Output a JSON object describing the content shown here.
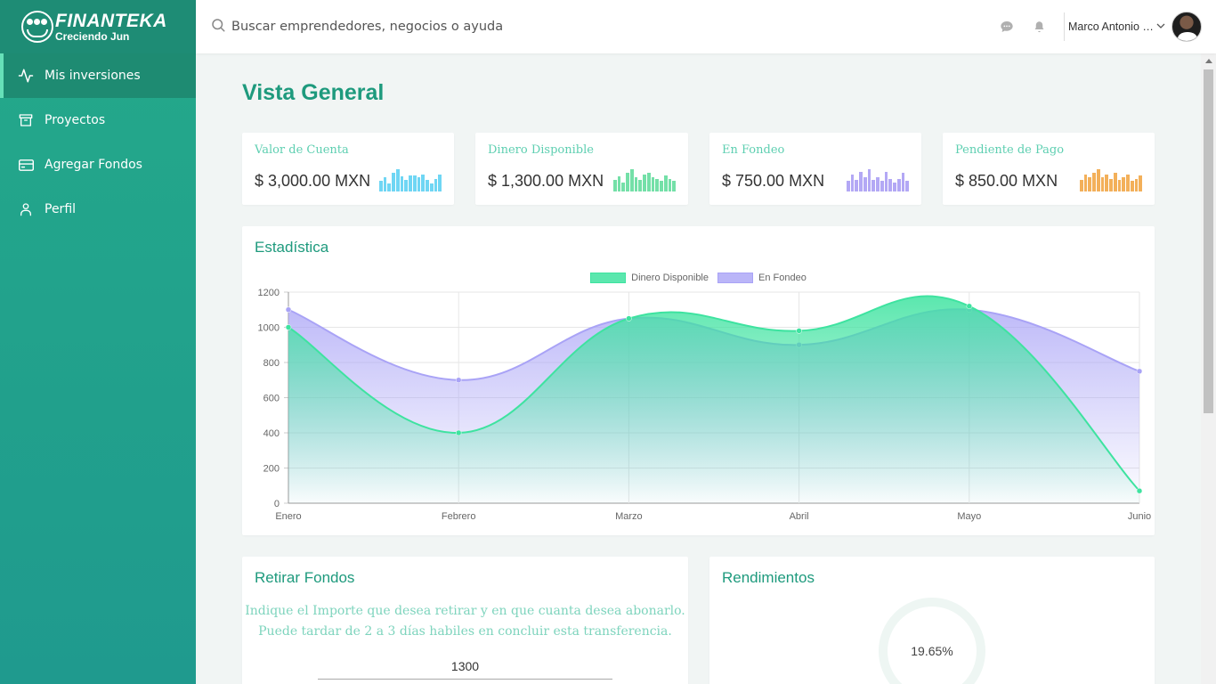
{
  "app": {
    "logo_name": "FINANTEKA",
    "logo_sub": "Creciendo Jun"
  },
  "sidebar": {
    "items": [
      {
        "label": "Mis inversiones",
        "icon": "activity-icon",
        "active": true
      },
      {
        "label": "Proyectos",
        "icon": "archive-icon",
        "active": false
      },
      {
        "label": "Agregar Fondos",
        "icon": "credit-card-icon",
        "active": false
      },
      {
        "label": "Perfil",
        "icon": "user-icon",
        "active": false
      }
    ]
  },
  "topbar": {
    "search_placeholder": "Buscar emprendedores, negocios o ayuda",
    "user_name": "Marco Antonio Me..."
  },
  "main": {
    "title": "Vista General",
    "stats": [
      {
        "label": "Valor de Cuenta",
        "value": "$ 3,000.00 MXN",
        "color": "#6fd6f4",
        "spark": [
          0.45,
          0.6,
          0.35,
          0.8,
          0.95,
          0.65,
          0.5,
          0.7,
          0.7,
          0.6,
          0.75,
          0.5,
          0.35,
          0.55,
          0.75
        ]
      },
      {
        "label": "Dinero Disponible",
        "value": "$ 1,300.00 MXN",
        "color": "#74e0a8",
        "spark": [
          0.5,
          0.65,
          0.4,
          0.8,
          0.95,
          0.6,
          0.5,
          0.75,
          0.8,
          0.6,
          0.55,
          0.45,
          0.7,
          0.55,
          0.45
        ]
      },
      {
        "label": "En Fondeo",
        "value": "$ 750.00 MXN",
        "color": "#b3a8f5",
        "spark": [
          0.45,
          0.75,
          0.5,
          0.85,
          0.6,
          0.95,
          0.5,
          0.6,
          0.45,
          0.85,
          0.55,
          0.4,
          0.55,
          0.8,
          0.45
        ]
      },
      {
        "label": "Pendiente de Pago",
        "value": "$ 850.00 MXN",
        "color": "#f3b05a",
        "spark": [
          0.5,
          0.75,
          0.6,
          0.8,
          0.95,
          0.6,
          0.75,
          0.55,
          0.8,
          0.5,
          0.6,
          0.75,
          0.45,
          0.55,
          0.7
        ]
      }
    ],
    "stats_card_title": "Estadística",
    "withdraw": {
      "title": "Retirar Fondos",
      "line1": "Indique el Importe que desea retirar y en que cuanta desea abonarlo.",
      "line2": "Puede tardar de 2 a 3 días habiles en concluir esta transferencia.",
      "amount": "1300"
    },
    "returns": {
      "title": "Rendimientos",
      "value": "19.65%"
    }
  },
  "chart_data": {
    "type": "area",
    "categories": [
      "Enero",
      "Febrero",
      "Marzo",
      "Abril",
      "Mayo",
      "Junio"
    ],
    "series": [
      {
        "name": "Dinero Disponible",
        "values": [
          1000,
          400,
          1050,
          980,
          1120,
          70
        ],
        "color": "#3ee3a0"
      },
      {
        "name": "En Fondeo",
        "values": [
          1100,
          700,
          1050,
          900,
          1100,
          750
        ],
        "color": "#a9a3f6"
      }
    ],
    "ylim": [
      0,
      1200
    ],
    "yticks": [
      0,
      200,
      400,
      600,
      800,
      1000,
      1200
    ],
    "grid": true,
    "legend": "top"
  }
}
